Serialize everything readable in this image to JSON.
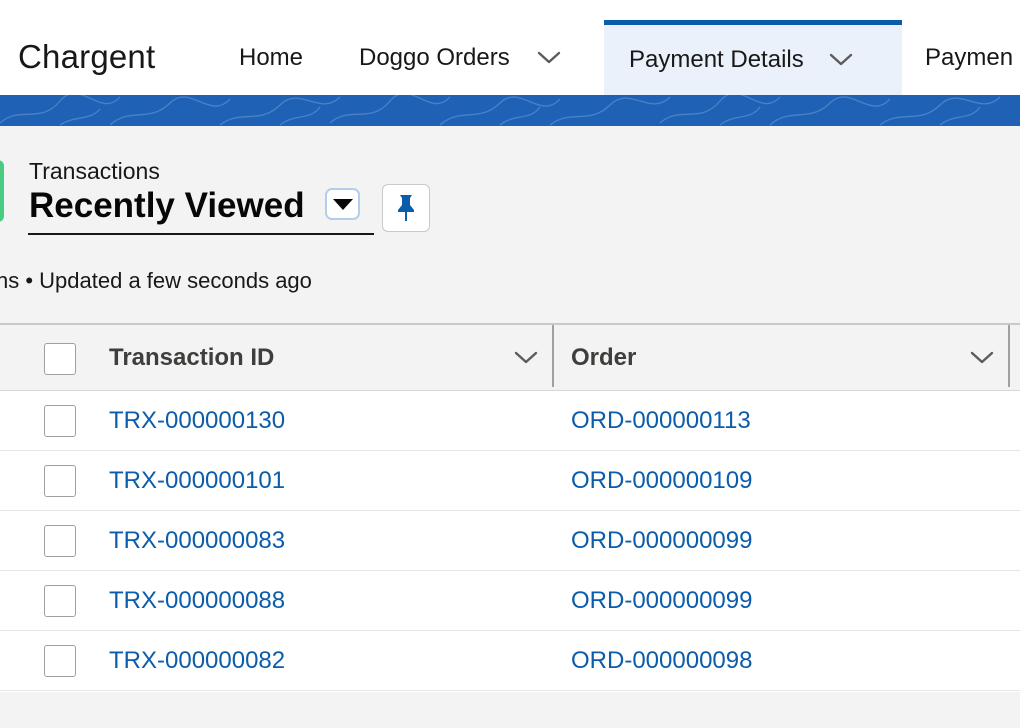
{
  "app": {
    "name": "Chargent"
  },
  "nav": {
    "items": [
      {
        "label": "Home"
      },
      {
        "label": "Doggo Orders"
      },
      {
        "label": "Payment Details"
      },
      {
        "label": "Paymen"
      }
    ]
  },
  "list": {
    "object_label": "Transactions",
    "view_name": "Recently Viewed",
    "info": "ns • Updated a few seconds ago"
  },
  "table": {
    "columns": [
      {
        "label": "Transaction ID"
      },
      {
        "label": "Order"
      }
    ],
    "rows": [
      {
        "transaction_id": "TRX-000000130",
        "order": "ORD-000000113"
      },
      {
        "transaction_id": "TRX-000000101",
        "order": "ORD-000000109"
      },
      {
        "transaction_id": "TRX-000000083",
        "order": "ORD-000000099"
      },
      {
        "transaction_id": "TRX-000000088",
        "order": "ORD-000000099"
      },
      {
        "transaction_id": "TRX-000000082",
        "order": "ORD-000000098"
      }
    ]
  },
  "colors": {
    "brand_blue": "#0b5cab",
    "nav_band": "#1f62b5",
    "app_icon": "#4bca81",
    "active_tab_bg": "#eaf1fb"
  },
  "icons": {
    "nav_dropdown": "chevron-down-icon",
    "list_view_dropdown": "caret-down-icon",
    "pin": "pin-icon",
    "column_menu": "chevron-down-icon"
  }
}
